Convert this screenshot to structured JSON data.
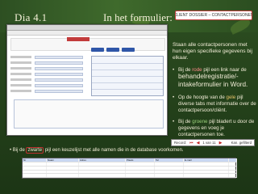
{
  "slide": {
    "title": "Dia 4.1",
    "heading": "In het formulier:",
    "callout": "CLIENT DOSSIER – CONTACTPERSONEN"
  },
  "panel": {
    "lead": "Staan alle contactpersonen met hun eigen specifieke gegevens bij elkaar.",
    "bullets": [
      {
        "prefix": "Bij de",
        "highlight": "rode",
        "suffix": "pijl een link naar de",
        "big": "behandelregistratie/-intakeformulier in Word."
      },
      {
        "prefix": "Op de hoogte van de",
        "highlight": "gele",
        "suffix": "pijl diverse tabs met informatie over de contactpersoon/cliënt."
      },
      {
        "prefix": "Bij de",
        "highlight": "groene",
        "suffix": "pijl bladert u door de gegevens en voeg je contactpersonen toe."
      }
    ]
  },
  "nav": {
    "record_label": "Record:",
    "record_info": "1 van 11",
    "right_label": "Kan. gefilterd"
  },
  "bottom": {
    "prefix": "Bij de",
    "word": "zwarte",
    "suffix": "pijl een keuzelijst met alle namen die in de database voorkomen."
  },
  "table": {
    "headers": [
      "Nr",
      "Naam",
      "Adres",
      "Plaats",
      "Tel",
      "E-mail",
      ""
    ],
    "rows": [
      [
        "",
        "",
        "",
        "",
        "",
        "",
        ""
      ],
      [
        "",
        "",
        "",
        "",
        "",
        "",
        ""
      ],
      [
        "",
        "",
        "",
        "",
        "",
        "",
        ""
      ],
      [
        "",
        "",
        "",
        "",
        "",
        "",
        ""
      ]
    ]
  }
}
